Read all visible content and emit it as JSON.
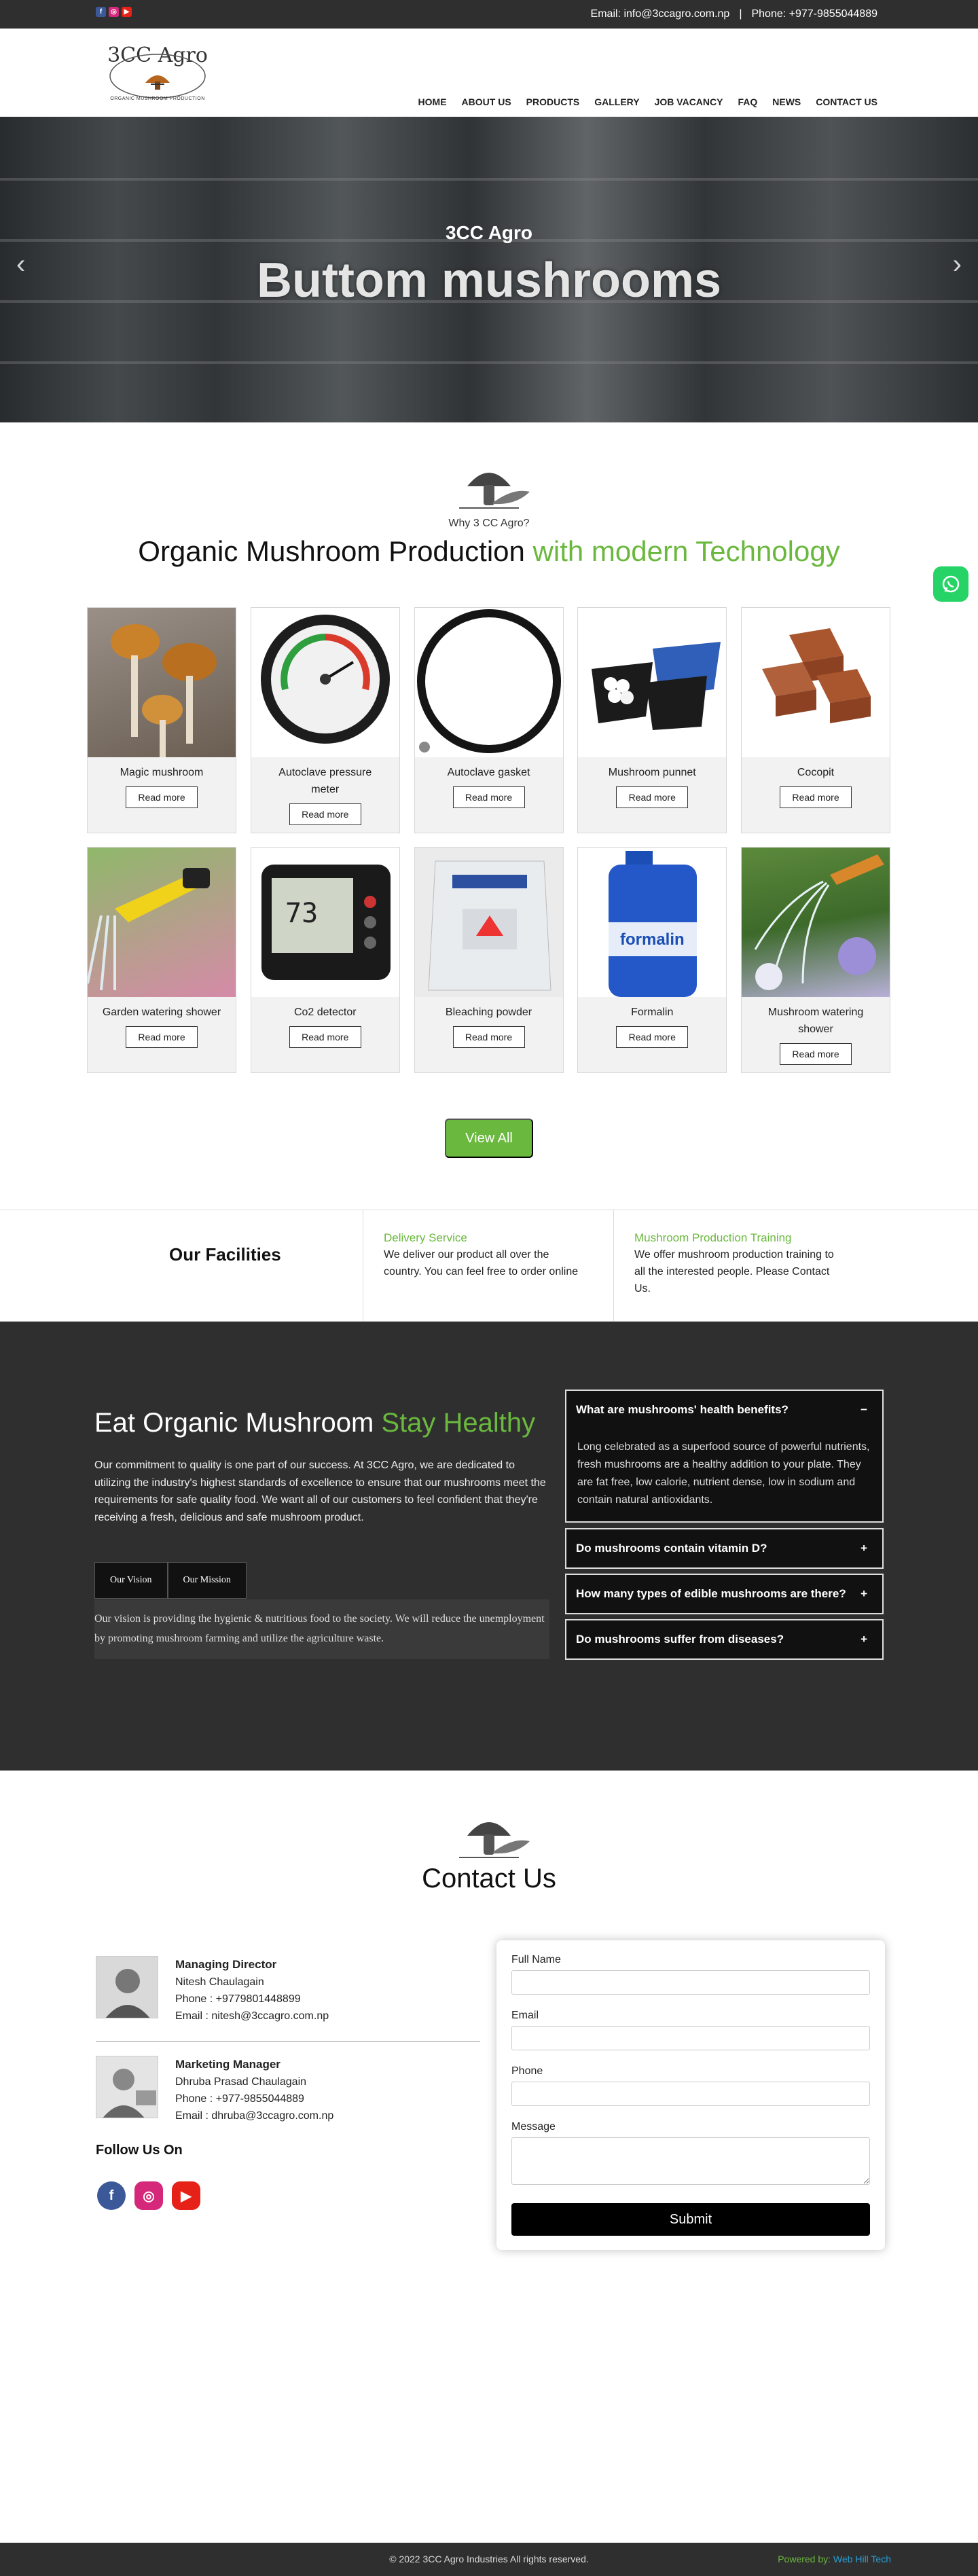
{
  "topbar": {
    "social": [
      "f",
      "◎",
      "▶"
    ],
    "email": "Email: info@3ccagro.com.np",
    "divider": "|",
    "phone": "Phone: +977-9855044889"
  },
  "logo": {
    "text": "3CC Agro",
    "tagline": "ORGANIC MUSHROOM PRODUCTION"
  },
  "nav": [
    "HOME",
    "ABOUT US",
    "PRODUCTS",
    "GALLERY",
    "JOB VACANCY",
    "FAQ",
    "NEWS",
    "CONTACT US"
  ],
  "hero": {
    "subtitle": "3CC Agro",
    "title": "Buttom mushrooms",
    "prev": "‹",
    "next": "›"
  },
  "why": {
    "label": "Why 3 CC Agro?",
    "title_main": "Organic Mushroom Production ",
    "title_accent": "with modern Technology"
  },
  "products": [
    {
      "name": "Magic mushroom",
      "btn": "Read more"
    },
    {
      "name": "Autoclave pressure meter",
      "btn": "Read more"
    },
    {
      "name": "Autoclave gasket",
      "btn": "Read more"
    },
    {
      "name": "Mushroom punnet",
      "btn": "Read more"
    },
    {
      "name": "Cocopit",
      "btn": "Read more"
    },
    {
      "name": "Garden watering shower",
      "btn": "Read more"
    },
    {
      "name": "Co2 detector",
      "btn": "Read more"
    },
    {
      "name": "Bleaching powder",
      "btn": "Read more"
    },
    {
      "name": "Formalin",
      "btn": "Read more"
    },
    {
      "name": "Mushroom watering shower",
      "btn": "Read more"
    }
  ],
  "view_all": "View All",
  "facilities": {
    "title": "Our Facilities",
    "items": [
      {
        "heading": "Delivery Service",
        "text": "We deliver our product all over the country. You can feel free to order online"
      },
      {
        "heading": "Mushroom Production Training",
        "text": "We offer mushroom production training to all the interested people. Please Contact Us."
      }
    ]
  },
  "about": {
    "title_main": "Eat Organic Mushroom ",
    "title_accent": "Stay Healthy",
    "paragraph": "Our commitment to quality is one part of our success. At 3CC Agro, we are dedicated to utilizing the industry's highest standards of excellence to ensure that our mushrooms meet the requirements for safe quality food. We want all of our customers to feel confident that they're receiving a fresh, delicious and safe mushroom product.",
    "tabs": [
      "Our Vision",
      "Our Mission"
    ],
    "vision_text": "Our vision is providing the hygienic & nutritious food to the society. We will reduce the unemployment by promoting mushroom farming and utilize the agriculture waste."
  },
  "faq": [
    {
      "q": "What are mushrooms' health benefits?",
      "icon": "−",
      "a": "Long celebrated as a superfood source of powerful nutrients, fresh mushrooms are a healthy addition to your plate. They are fat free, low calorie, nutrient dense, low in sodium and contain natural antioxidants."
    },
    {
      "q": "Do mushrooms contain vitamin D?",
      "icon": "+"
    },
    {
      "q": "How many types of edible mushrooms are there?",
      "icon": "+"
    },
    {
      "q": "Do mushrooms suffer from diseases?",
      "icon": "+"
    }
  ],
  "contact": {
    "title": "Contact Us",
    "people": [
      {
        "role": "Managing Director",
        "name": "Nitesh Chaulagain",
        "phone": "Phone : +9779801448899",
        "email": "Email : nitesh@3ccagro.com.np"
      },
      {
        "role": "Marketing Manager",
        "name": "Dhruba Prasad Chaulagain",
        "phone": "Phone : +977-9855044889",
        "email": "Email : dhruba@3ccagro.com.np"
      }
    ],
    "follow": "Follow Us On",
    "social": [
      "f",
      "◎",
      "▶"
    ],
    "form": {
      "full_name": "Full Name",
      "email": "Email",
      "phone": "Phone",
      "message": "Message",
      "submit": "Submit"
    }
  },
  "footer": {
    "copyright": "© 2022 3CC Agro Industries All rights reserved.",
    "powered_prefix": "Powered by: ",
    "powered_by": "Web Hill Tech"
  },
  "whatsapp_icon": "whatsapp-icon"
}
